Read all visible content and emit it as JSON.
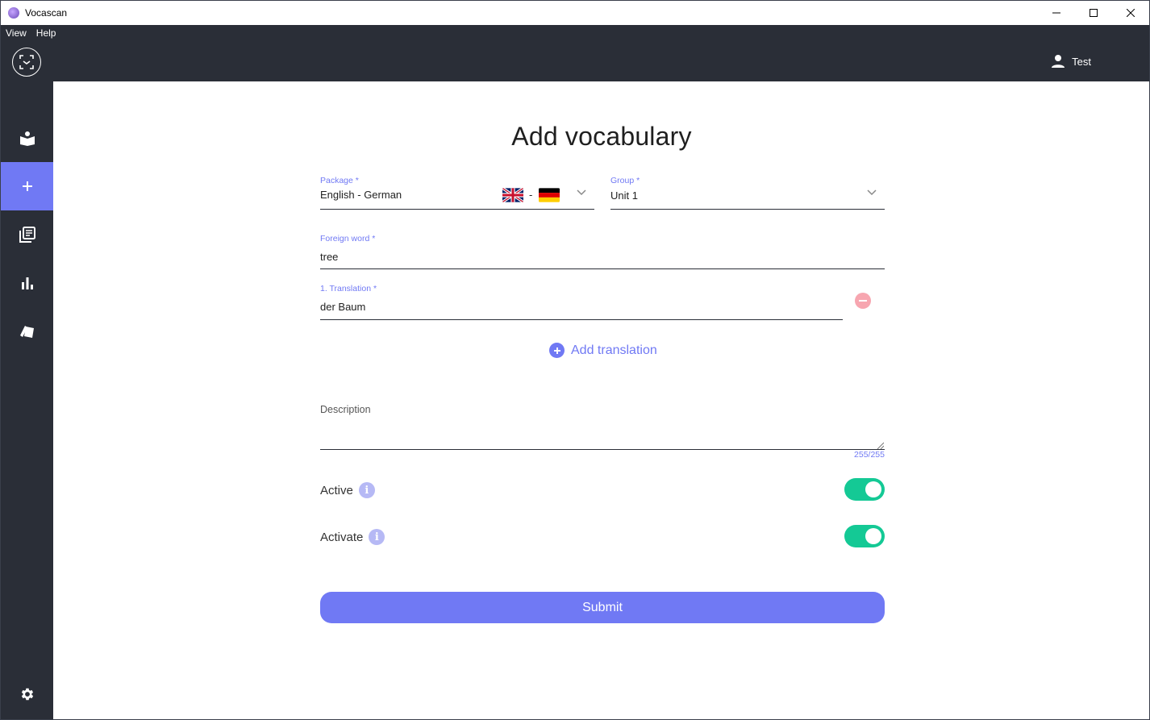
{
  "window": {
    "title": "Vocascan"
  },
  "menubar": {
    "items": [
      "View",
      "Help"
    ]
  },
  "header": {
    "user_name": "Test"
  },
  "sidebar": {
    "items": [
      {
        "name": "learn",
        "icon": "learn-book-icon"
      },
      {
        "name": "add-vocabulary",
        "icon": "plus-icon",
        "active": true
      },
      {
        "name": "library",
        "icon": "library-icon"
      },
      {
        "name": "statistics",
        "icon": "bar-chart-icon"
      },
      {
        "name": "cards",
        "icon": "cards-icon"
      }
    ],
    "settings_icon": "gear-icon"
  },
  "form": {
    "title": "Add vocabulary",
    "package": {
      "label": "Package *",
      "value": "English - German",
      "flag_separator": "-",
      "flags": [
        "gb-flag",
        "de-flag"
      ]
    },
    "group": {
      "label": "Group *",
      "value": "Unit 1"
    },
    "foreign_word": {
      "label": "Foreign word *",
      "value": "tree"
    },
    "translation": {
      "label": "1. Translation *",
      "value": "der Baum"
    },
    "add_translation_label": "Add translation",
    "description": {
      "label": "Description",
      "value": "",
      "counter": "255/255"
    },
    "active": {
      "label": "Active",
      "on": true
    },
    "activate": {
      "label": "Activate",
      "on": true
    },
    "submit_label": "Submit"
  },
  "colors": {
    "accent": "#7079f4",
    "dark": "#2a2e37",
    "toggle_on": "#14c995",
    "danger": "#f7a6b0"
  }
}
